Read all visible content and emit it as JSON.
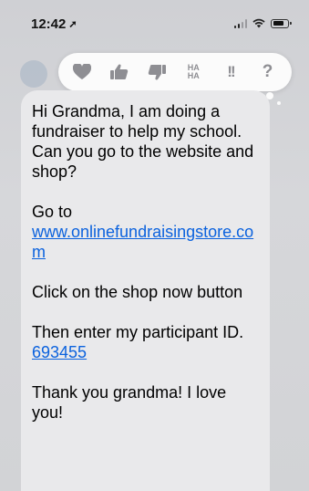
{
  "status": {
    "time": "12:42",
    "location_icon": "location-arrow-icon",
    "icons": [
      "signal-icon",
      "wifi-icon",
      "battery-icon"
    ]
  },
  "tapbacks": [
    {
      "name": "heart-icon",
      "label": "♥"
    },
    {
      "name": "thumbs-up-icon",
      "label": "👍"
    },
    {
      "name": "thumbs-down-icon",
      "label": "👎"
    },
    {
      "name": "haha-icon",
      "label_line1": "HA",
      "label_line2": "HA"
    },
    {
      "name": "exclamation-icon",
      "label": "!!"
    },
    {
      "name": "question-icon",
      "label": "?"
    }
  ],
  "message": {
    "p1": "Hi Grandma, I am doing a fundraiser to help my school.  Can you go to the website and shop?",
    "p2_prefix": "Go to",
    "p2_link": "www.onlinefundraisingstore.com",
    "p3": "Click on the shop now button",
    "p4_prefix": "Then enter my participant ID.",
    "p4_id": "693455",
    "p5": "Thank you grandma!  I love you!"
  },
  "colors": {
    "bubble": "#e9e9eb",
    "link": "#0b62de",
    "tapback_icon": "#8e8e93"
  }
}
